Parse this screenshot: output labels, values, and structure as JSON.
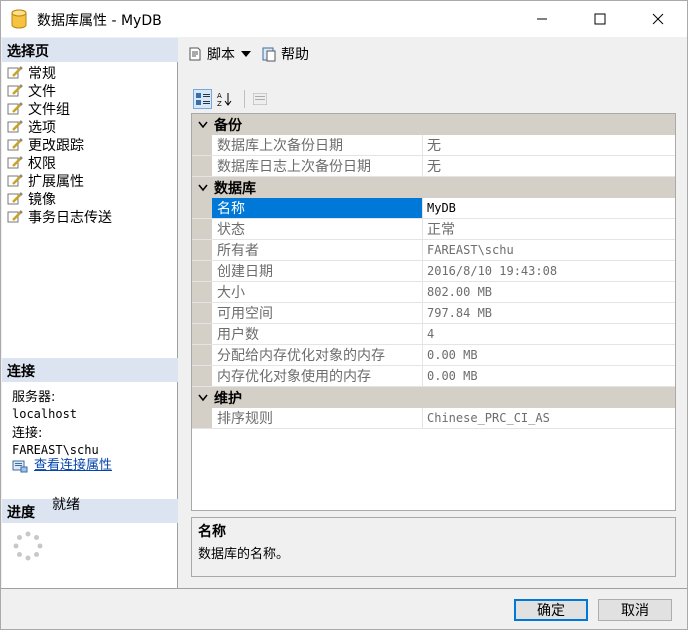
{
  "window": {
    "title": "数据库属性 - MyDB"
  },
  "left_panel": {
    "select_page_header": "选择页",
    "nav_items": [
      "常规",
      "文件",
      "文件组",
      "选项",
      "更改跟踪",
      "权限",
      "扩展属性",
      "镜像",
      "事务日志传送"
    ],
    "connection_header": "连接",
    "server_label": "服务器:",
    "server_value": "localhost",
    "connection_label": "连接:",
    "connection_value": "FAREAST\\schu",
    "view_conn_link": "查看连接属性",
    "progress_header": "进度",
    "progress_status": "就绪"
  },
  "toolbar": {
    "script_label": "脚本",
    "help_label": "帮助"
  },
  "grid": {
    "categories": [
      {
        "label": "备份",
        "rows": [
          {
            "name": "数据库上次备份日期",
            "value": "无"
          },
          {
            "name": "数据库日志上次备份日期",
            "value": "无"
          }
        ]
      },
      {
        "label": "数据库",
        "rows": [
          {
            "name": "名称",
            "value": "MyDB"
          },
          {
            "name": "状态",
            "value": "正常"
          },
          {
            "name": "所有者",
            "value": "FAREAST\\schu"
          },
          {
            "name": "创建日期",
            "value": "2016/8/10 19:43:08"
          },
          {
            "name": "大小",
            "value": "802.00 MB"
          },
          {
            "name": "可用空间",
            "value": "797.84 MB"
          },
          {
            "name": "用户数",
            "value": "4"
          },
          {
            "name": "分配给内存优化对象的内存",
            "value": "0.00 MB"
          },
          {
            "name": "内存优化对象使用的内存",
            "value": "0.00 MB"
          }
        ]
      },
      {
        "label": "维护",
        "rows": [
          {
            "name": "排序规则",
            "value": "Chinese_PRC_CI_AS"
          }
        ]
      }
    ]
  },
  "description": {
    "title": "名称",
    "text": "数据库的名称。"
  },
  "buttons": {
    "ok": "确定",
    "cancel": "取消"
  },
  "colors": {
    "selection": "#0078d7",
    "category_bg": "#d4d0c8",
    "section_bg": "#dbe4f0"
  }
}
